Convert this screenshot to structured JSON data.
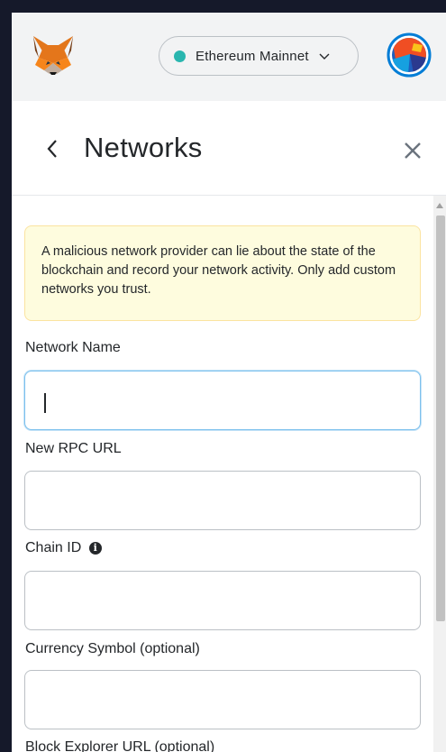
{
  "header": {
    "network": {
      "name": "Ethereum Mainnet",
      "status_color": "#29b6af"
    }
  },
  "page": {
    "title": "Networks"
  },
  "warning": {
    "text": "A malicious network provider can lie about the state of the blockchain and record your network activity. Only add custom networks you trust."
  },
  "form": {
    "network_name": {
      "label": "Network Name",
      "value": ""
    },
    "rpc_url": {
      "label": "New RPC URL",
      "value": ""
    },
    "chain_id": {
      "label": "Chain ID",
      "value": "",
      "info_icon": "i"
    },
    "currency_symbol": {
      "label": "Currency Symbol (optional)",
      "value": ""
    },
    "block_explorer": {
      "label": "Block Explorer URL (optional)"
    }
  },
  "icons": {
    "logo": "metamask-fox-icon",
    "chevron": "chevron-down-icon",
    "back": "chevron-left-icon",
    "close": "close-icon",
    "info": "info-icon"
  }
}
